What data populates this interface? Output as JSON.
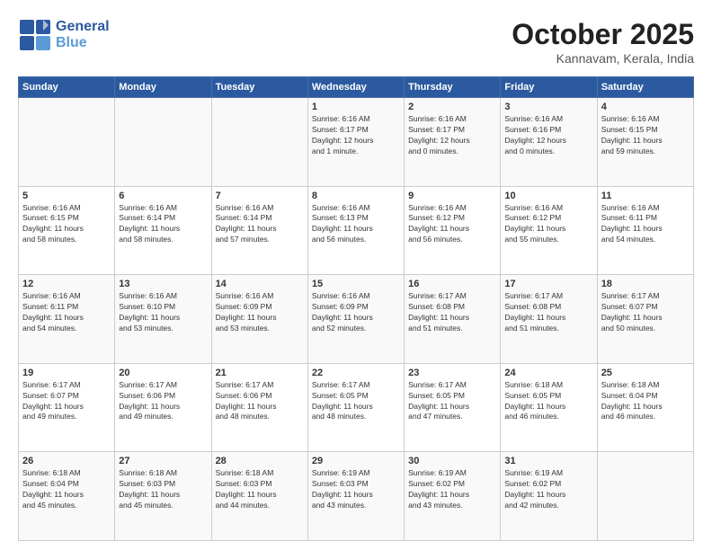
{
  "header": {
    "logo_line1": "General",
    "logo_line2": "Blue",
    "month": "October 2025",
    "location": "Kannavam, Kerala, India"
  },
  "days_of_week": [
    "Sunday",
    "Monday",
    "Tuesday",
    "Wednesday",
    "Thursday",
    "Friday",
    "Saturday"
  ],
  "weeks": [
    [
      {
        "day": "",
        "info": ""
      },
      {
        "day": "",
        "info": ""
      },
      {
        "day": "",
        "info": ""
      },
      {
        "day": "1",
        "info": "Sunrise: 6:16 AM\nSunset: 6:17 PM\nDaylight: 12 hours\nand 1 minute."
      },
      {
        "day": "2",
        "info": "Sunrise: 6:16 AM\nSunset: 6:17 PM\nDaylight: 12 hours\nand 0 minutes."
      },
      {
        "day": "3",
        "info": "Sunrise: 6:16 AM\nSunset: 6:16 PM\nDaylight: 12 hours\nand 0 minutes."
      },
      {
        "day": "4",
        "info": "Sunrise: 6:16 AM\nSunset: 6:15 PM\nDaylight: 11 hours\nand 59 minutes."
      }
    ],
    [
      {
        "day": "5",
        "info": "Sunrise: 6:16 AM\nSunset: 6:15 PM\nDaylight: 11 hours\nand 58 minutes."
      },
      {
        "day": "6",
        "info": "Sunrise: 6:16 AM\nSunset: 6:14 PM\nDaylight: 11 hours\nand 58 minutes."
      },
      {
        "day": "7",
        "info": "Sunrise: 6:16 AM\nSunset: 6:14 PM\nDaylight: 11 hours\nand 57 minutes."
      },
      {
        "day": "8",
        "info": "Sunrise: 6:16 AM\nSunset: 6:13 PM\nDaylight: 11 hours\nand 56 minutes."
      },
      {
        "day": "9",
        "info": "Sunrise: 6:16 AM\nSunset: 6:12 PM\nDaylight: 11 hours\nand 56 minutes."
      },
      {
        "day": "10",
        "info": "Sunrise: 6:16 AM\nSunset: 6:12 PM\nDaylight: 11 hours\nand 55 minutes."
      },
      {
        "day": "11",
        "info": "Sunrise: 6:16 AM\nSunset: 6:11 PM\nDaylight: 11 hours\nand 54 minutes."
      }
    ],
    [
      {
        "day": "12",
        "info": "Sunrise: 6:16 AM\nSunset: 6:11 PM\nDaylight: 11 hours\nand 54 minutes."
      },
      {
        "day": "13",
        "info": "Sunrise: 6:16 AM\nSunset: 6:10 PM\nDaylight: 11 hours\nand 53 minutes."
      },
      {
        "day": "14",
        "info": "Sunrise: 6:16 AM\nSunset: 6:09 PM\nDaylight: 11 hours\nand 53 minutes."
      },
      {
        "day": "15",
        "info": "Sunrise: 6:16 AM\nSunset: 6:09 PM\nDaylight: 11 hours\nand 52 minutes."
      },
      {
        "day": "16",
        "info": "Sunrise: 6:17 AM\nSunset: 6:08 PM\nDaylight: 11 hours\nand 51 minutes."
      },
      {
        "day": "17",
        "info": "Sunrise: 6:17 AM\nSunset: 6:08 PM\nDaylight: 11 hours\nand 51 minutes."
      },
      {
        "day": "18",
        "info": "Sunrise: 6:17 AM\nSunset: 6:07 PM\nDaylight: 11 hours\nand 50 minutes."
      }
    ],
    [
      {
        "day": "19",
        "info": "Sunrise: 6:17 AM\nSunset: 6:07 PM\nDaylight: 11 hours\nand 49 minutes."
      },
      {
        "day": "20",
        "info": "Sunrise: 6:17 AM\nSunset: 6:06 PM\nDaylight: 11 hours\nand 49 minutes."
      },
      {
        "day": "21",
        "info": "Sunrise: 6:17 AM\nSunset: 6:06 PM\nDaylight: 11 hours\nand 48 minutes."
      },
      {
        "day": "22",
        "info": "Sunrise: 6:17 AM\nSunset: 6:05 PM\nDaylight: 11 hours\nand 48 minutes."
      },
      {
        "day": "23",
        "info": "Sunrise: 6:17 AM\nSunset: 6:05 PM\nDaylight: 11 hours\nand 47 minutes."
      },
      {
        "day": "24",
        "info": "Sunrise: 6:18 AM\nSunset: 6:05 PM\nDaylight: 11 hours\nand 46 minutes."
      },
      {
        "day": "25",
        "info": "Sunrise: 6:18 AM\nSunset: 6:04 PM\nDaylight: 11 hours\nand 46 minutes."
      }
    ],
    [
      {
        "day": "26",
        "info": "Sunrise: 6:18 AM\nSunset: 6:04 PM\nDaylight: 11 hours\nand 45 minutes."
      },
      {
        "day": "27",
        "info": "Sunrise: 6:18 AM\nSunset: 6:03 PM\nDaylight: 11 hours\nand 45 minutes."
      },
      {
        "day": "28",
        "info": "Sunrise: 6:18 AM\nSunset: 6:03 PM\nDaylight: 11 hours\nand 44 minutes."
      },
      {
        "day": "29",
        "info": "Sunrise: 6:19 AM\nSunset: 6:03 PM\nDaylight: 11 hours\nand 43 minutes."
      },
      {
        "day": "30",
        "info": "Sunrise: 6:19 AM\nSunset: 6:02 PM\nDaylight: 11 hours\nand 43 minutes."
      },
      {
        "day": "31",
        "info": "Sunrise: 6:19 AM\nSunset: 6:02 PM\nDaylight: 11 hours\nand 42 minutes."
      },
      {
        "day": "",
        "info": ""
      }
    ]
  ]
}
